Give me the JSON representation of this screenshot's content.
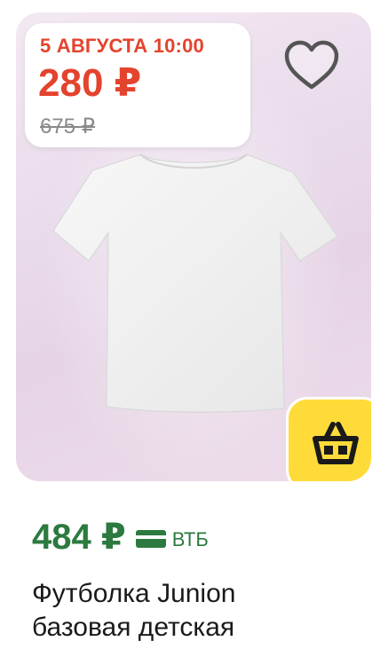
{
  "product_image": {
    "alt_icon": "white-tshirt"
  },
  "sale_badge": {
    "date_time": "5 АВГУСТА 10:00",
    "sale_price": "280 ₽",
    "old_price": "675 ₽",
    "accent_color": "#e4432d"
  },
  "favorite": {
    "icon": "heart-outline-icon"
  },
  "cart": {
    "icon": "shopping-basket-icon",
    "background_color": "#ffdb3a"
  },
  "price": {
    "value": "484 ₽",
    "bank_icon": "bank-card-icon",
    "bank_label": "ВТБ",
    "color": "#2c7a3f"
  },
  "title": {
    "line1": "Футболка Junion",
    "line2": "базовая детская"
  }
}
